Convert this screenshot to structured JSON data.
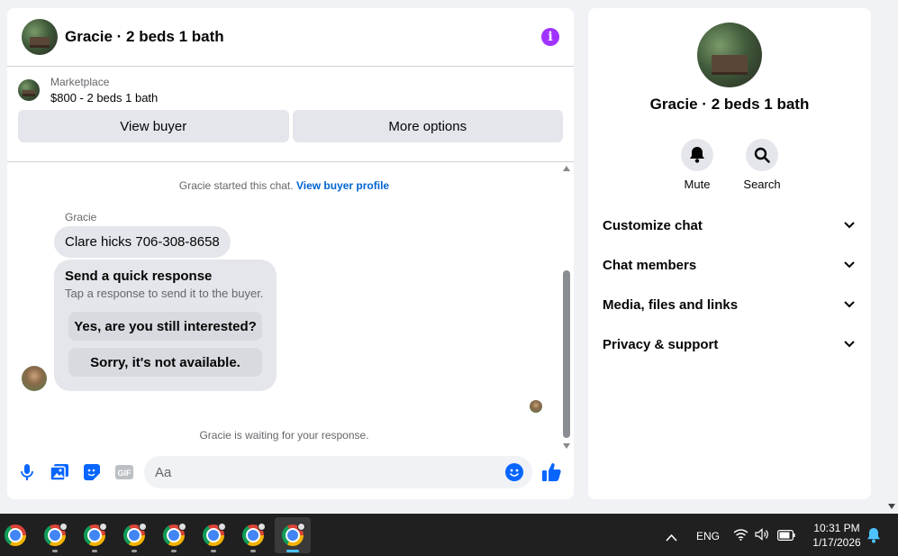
{
  "chat": {
    "title": "Gracie · 2 beds 1 bath",
    "listing": {
      "label": "Marketplace",
      "price_title": "$800 - 2 beds 1 bath",
      "view_buyer": "View buyer",
      "more_options": "More options"
    },
    "started_text": "Gracie started this chat.",
    "view_buyer_profile": "View buyer profile",
    "sender": "Gracie",
    "message": "Clare hicks 706-308-8658",
    "quick_response": {
      "title": "Send a quick response",
      "subtitle": "Tap a response to send it to the buyer.",
      "option1": "Yes, are you still interested?",
      "option2": "Sorry, it's not available."
    },
    "waiting_text": "Gracie is waiting for your response.",
    "composer_placeholder": "Aa"
  },
  "details": {
    "title": "Gracie · 2 beds 1 bath",
    "mute_label": "Mute",
    "search_label": "Search",
    "sections": [
      "Customize chat",
      "Chat members",
      "Media, files and links",
      "Privacy & support"
    ]
  },
  "taskbar": {
    "language": "ENG",
    "time": "10:31 PM",
    "date": "1/17/2026"
  },
  "colors": {
    "accent_blue": "#0866ff",
    "info_purple": "#a033ff",
    "link_blue": "#0064d1"
  }
}
